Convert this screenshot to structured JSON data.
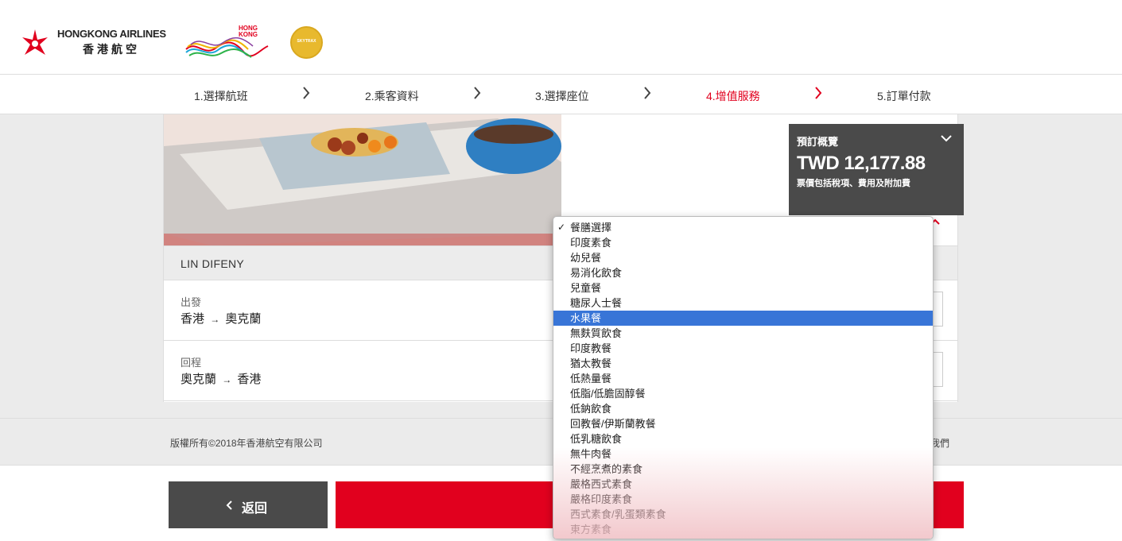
{
  "header": {
    "airline_name_en": "HONGKONG AIRLINES",
    "airline_name_zh": "香港航空",
    "hk_brand": "HONG\nKONG",
    "skytrax_badge": "SKYTRAX",
    "brand_color": "#e1001e"
  },
  "steps": [
    {
      "label": "1.選擇航班",
      "active": false
    },
    {
      "label": "2.乘客資料",
      "active": false
    },
    {
      "label": "3.選擇座位",
      "active": false
    },
    {
      "label": "4.增值服務",
      "active": true
    },
    {
      "label": "5.訂單付款",
      "active": false
    }
  ],
  "summary": {
    "title": "預訂概覽",
    "price": "TWD 12,177.88",
    "note": "票價包括稅項、費用及附加費"
  },
  "passenger": {
    "name": "LIN DIFENY"
  },
  "flights": [
    {
      "label": "出發",
      "from": "香港",
      "arrow": "→",
      "to": "奧克蘭"
    },
    {
      "label": "回程",
      "from": "奧克蘭",
      "arrow": "→",
      "to": "香港"
    }
  ],
  "meal_dropdown": {
    "options": [
      "餐膳選擇",
      "印度素食",
      "幼兒餐",
      "易消化飲食",
      "兒童餐",
      "糖尿人士餐",
      "水果餐",
      "無麩質飲食",
      "印度教餐",
      "猶太教餐",
      "低熱量餐",
      "低脂/低膽固醇餐",
      "低鈉飲食",
      "回教餐/伊斯蘭教餐",
      "低乳糖飲食",
      "無牛肉餐",
      "不經烹煮的素食",
      "嚴格西式素食",
      "嚴格印度素食",
      "西式素食/乳蛋類素食",
      "東方素食"
    ],
    "checked_index": 0,
    "highlighted_index": 6,
    "highlight_color": "#3875d7"
  },
  "footer": {
    "copyright": "版權所有©2018年香港航空有限公司",
    "contact_partial": "我們"
  },
  "buttons": {
    "back_label": "返回"
  }
}
